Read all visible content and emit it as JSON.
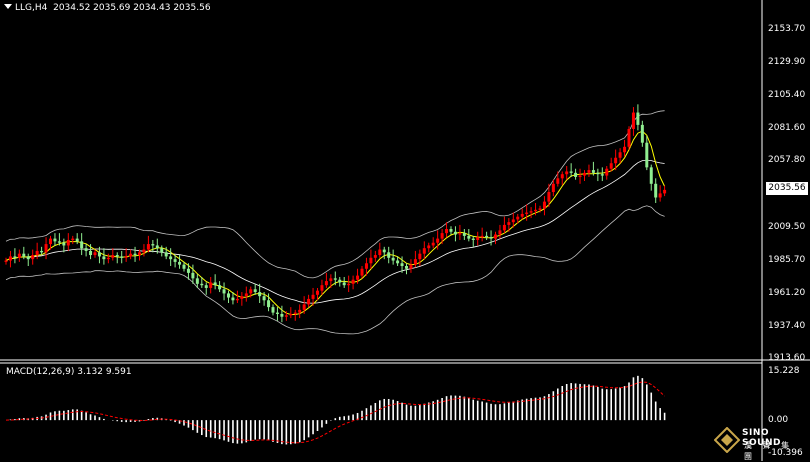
{
  "header": {
    "symbol": "LLG,H4",
    "ohlc": "2034.52 2035.69 2034.43 2035.56"
  },
  "price_axis": {
    "ticks": [
      "2153.70",
      "2129.90",
      "2105.40",
      "2081.60",
      "2057.80",
      "2009.50",
      "1985.70",
      "1961.20",
      "1937.40",
      "1913.60"
    ],
    "current_price": "2035.56"
  },
  "macd": {
    "label": "MACD(12,26,9) 3.132 9.591",
    "ticks": [
      "15.228",
      "0.00",
      "-10.396"
    ]
  },
  "logo": {
    "name": "SINO SOUND",
    "chinese": "漢 聲 集 團"
  },
  "colors": {
    "background": "#000000",
    "up_candle": "#ff0000",
    "down_candle": "#90ee90",
    "bands": "#c0c0c0",
    "ma": "#ffff00",
    "macd_hist": "#ffffff",
    "macd_signal": "#ff0000"
  },
  "chart_data": {
    "type": "candlestick",
    "symbol": "LLG",
    "timeframe": "H4",
    "ylim": [
      1913.6,
      2153.7
    ],
    "close": [
      1984,
      1987,
      1986,
      1989,
      1987,
      1985,
      1988,
      1991,
      1990,
      1996,
      2000,
      1998,
      1997,
      1995,
      1999,
      2000,
      1998,
      1993,
      1991,
      1988,
      1990,
      1987,
      1985,
      1986,
      1988,
      1987,
      1986,
      1987,
      1989,
      1988,
      1990,
      1992,
      1996,
      1995,
      1993,
      1990,
      1987,
      1985,
      1983,
      1981,
      1978,
      1975,
      1971,
      1967,
      1966,
      1964,
      1968,
      1966,
      1963,
      1960,
      1957,
      1955,
      1956,
      1958,
      1960,
      1963,
      1961,
      1958,
      1955,
      1950,
      1946,
      1945,
      1943,
      1944,
      1945,
      1946,
      1948,
      1952,
      1956,
      1959,
      1962,
      1966,
      1969,
      1971,
      1970,
      1968,
      1966,
      1967,
      1970,
      1973,
      1978,
      1982,
      1986,
      1988,
      1992,
      1990,
      1986,
      1984,
      1982,
      1980,
      1978,
      1981,
      1985,
      1989,
      1993,
      1995,
      1997,
      2000,
      2004,
      2007,
      2005,
      2003,
      2004,
      2002,
      2000,
      1999,
      2001,
      2002,
      2001,
      2000,
      2003,
      2006,
      2010,
      2012,
      2014,
      2016,
      2018,
      2019,
      2020,
      2021,
      2022,
      2027,
      2034,
      2040,
      2044,
      2047,
      2049,
      2048,
      2045,
      2046,
      2048,
      2050,
      2048,
      2047,
      2046,
      2051,
      2055,
      2059,
      2063,
      2067,
      2080,
      2092,
      2083,
      2070,
      2052,
      2040,
      2030,
      2033,
      2035.56
    ],
    "macd_histogram_range": [
      -10.396,
      15.228
    ]
  }
}
